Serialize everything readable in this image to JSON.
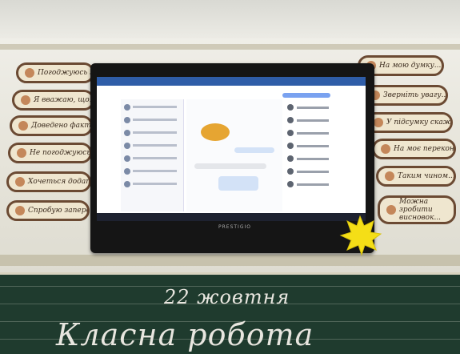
{
  "signs_left": [
    "Погоджуюсь з думкою...",
    "Я вважаю, що...",
    "Доведено фактами...",
    "Не погоджуюсь з тим, що...",
    "Хочеться додати, що...",
    "Спробую заперечити"
  ],
  "signs_right": [
    "На мою думку...",
    "Зверніть увагу...",
    "У підсумку скажу...",
    "На моє переконання...",
    "Таким чином...",
    "Можна зробити висновок..."
  ],
  "tv": {
    "brand": "PRESTIGIO"
  },
  "board": {
    "date": "22 жовтня",
    "heading": "Класна робота"
  },
  "colors": {
    "board": "#1f3b2e",
    "sign_border": "#6b4a33",
    "app_header": "#2f5da8",
    "leaf": "#f4de17"
  }
}
